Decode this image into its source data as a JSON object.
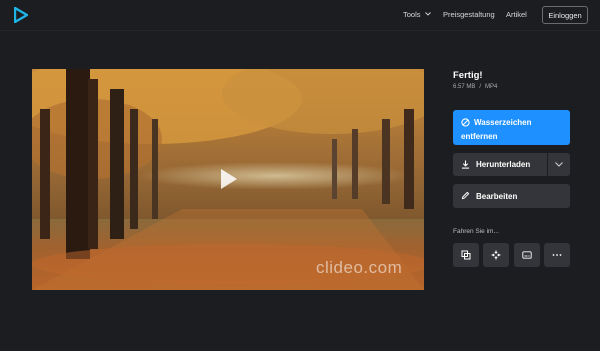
{
  "header": {
    "logo_icon": "clideo-play-logo",
    "nav": {
      "tools_label": "Tools",
      "pricing_label": "Preisgestaltung",
      "articles_label": "Artikel"
    },
    "login_label": "Einloggen"
  },
  "video": {
    "watermark_text": "clideo.com",
    "play_icon": "play-icon"
  },
  "result": {
    "title": "Fertig!",
    "size": "6.57 MB",
    "separator": "/",
    "format": "MP4"
  },
  "actions": {
    "remove_watermark_line1": "Wasserzeichen",
    "remove_watermark_line2": "entfernen",
    "download_label": "Herunterladen",
    "edit_label": "Bearbeiten",
    "continue_label": "Fahren Sie im..."
  },
  "tools": [
    {
      "icon": "merge-icon"
    },
    {
      "icon": "compress-icon"
    },
    {
      "icon": "subtitles-icon"
    },
    {
      "icon": "more-icon"
    }
  ],
  "colors": {
    "background": "#1c1d21",
    "accent": "#1e90ff",
    "button": "#34353a",
    "logo": "#1fb4e6"
  }
}
